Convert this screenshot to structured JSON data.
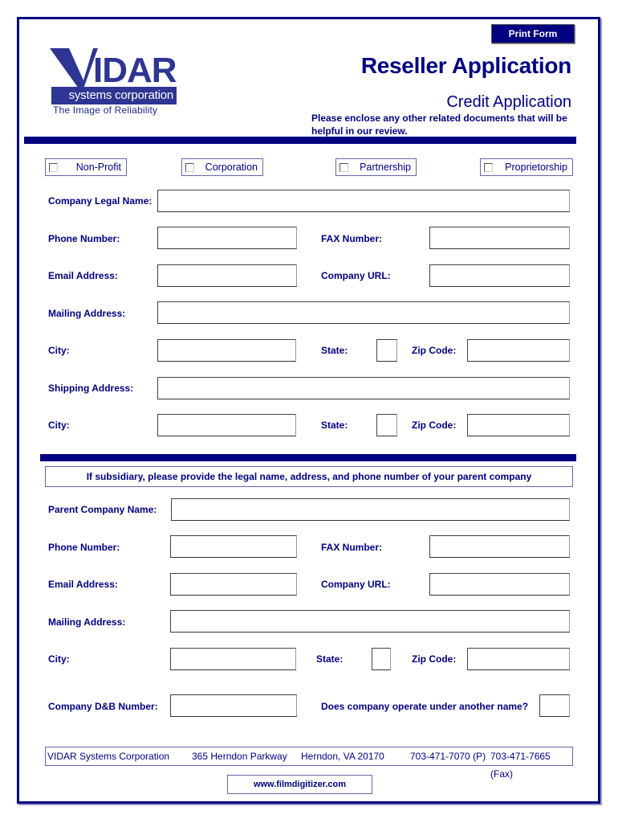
{
  "header": {
    "print_button": "Print Form",
    "logo": {
      "wordmark": "VIDAR",
      "company": "systems corporation",
      "tagline": "The Image of Reliability"
    },
    "title": "Reseller Application",
    "subtitle": "Credit Application",
    "note": "Please enclose any other related  documents that will be helpful in our review."
  },
  "colors": {
    "primary": "#000080",
    "logo_blue": "#2e3592",
    "border_light": "#6666aa"
  },
  "business_type": {
    "options": [
      {
        "label": "Non-Profit",
        "checked": false
      },
      {
        "label": "Corporation",
        "checked": false
      },
      {
        "label": "Partnership",
        "checked": false
      },
      {
        "label": "Proprietorship",
        "checked": false
      }
    ]
  },
  "company": {
    "legal_name_label": "Company Legal Name:",
    "legal_name_value": "",
    "phone_label": "Phone Number:",
    "phone_value": "",
    "fax_label": "FAX Number:",
    "fax_value": "",
    "email_label": "Email Address:",
    "email_value": "",
    "url_label": "Company URL:",
    "url_value": "",
    "mailing_label": "Mailing Address:",
    "mailing_value": "",
    "city_label": "City:",
    "city_value": "",
    "state_label": "State:",
    "state_value": "",
    "zip_label": "Zip Code:",
    "zip_value": "",
    "shipping_label": "Shipping Address:",
    "shipping_value": "",
    "ship_city_label": "City:",
    "ship_city_value": "",
    "ship_state_label": "State:",
    "ship_state_value": "",
    "ship_zip_label": "Zip Code:",
    "ship_zip_value": ""
  },
  "parent": {
    "banner": "If subsidiary, please provide the legal name, address, and phone number of your parent company",
    "name_label": "Parent Company Name:",
    "name_value": "",
    "phone_label": "Phone Number:",
    "phone_value": "",
    "fax_label": "FAX Number:",
    "fax_value": "",
    "email_label": "Email Address:",
    "email_value": "",
    "url_label": "Company URL:",
    "url_value": "",
    "mailing_label": "Mailing Address:",
    "mailing_value": "",
    "city_label": "City:",
    "city_value": "",
    "state_label": "State:",
    "state_value": "",
    "zip_label": "Zip Code:",
    "zip_value": "",
    "dnb_label": "Company D&B Number:",
    "dnb_value": "",
    "other_name_label": "Does company operate under another name?",
    "other_name_value": ""
  },
  "footer": {
    "company": "VIDAR Systems Corporation",
    "street": "365 Herndon Parkway",
    "city": "Herndon, VA  20170",
    "phone": "703-471-7070 (P)",
    "fax": "703-471-7665 (Fax)",
    "website": "www.filmdigitizer.com"
  }
}
